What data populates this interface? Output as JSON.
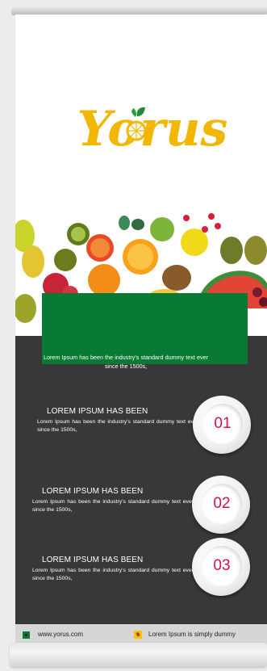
{
  "brand": {
    "name": "Yorus"
  },
  "intro": {
    "text": "Lorem Ipsum has been the industry's standard dummy text ever since the 1500s,"
  },
  "items": [
    {
      "title": "LOREM IPSUM HAS BEEN",
      "body": "Lorem Ipsum has been the industry's standard dummy text ever since the 1500s,",
      "number": "01"
    },
    {
      "title": "LOREM IPSUM HAS BEEN",
      "body": "Lorem Ipsum has been the industry's standard dummy text ever since the 1500s,",
      "number": "02"
    },
    {
      "title": "LOREM IPSUM HAS BEEN",
      "body": "Lorem Ipsum has been the industry's standard dummy text ever since the 1500s,",
      "number": "03"
    }
  ],
  "footer": {
    "website": "www.yorus.com",
    "address": "Lorem Ipsum is simply dummy"
  },
  "colors": {
    "brand_yellow": "#f2b705",
    "green": "#087a34",
    "dark": "#393838",
    "accent": "#d1124a"
  }
}
